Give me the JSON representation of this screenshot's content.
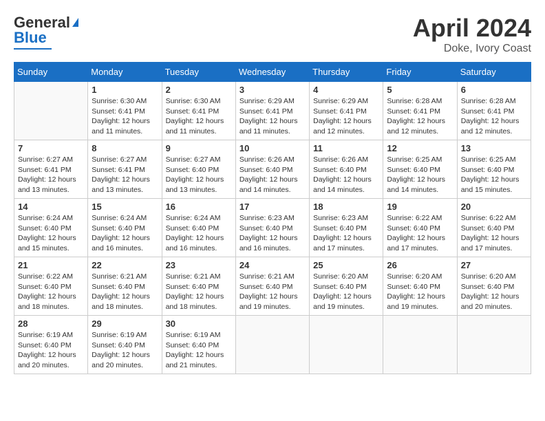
{
  "header": {
    "logo_line1": "General",
    "logo_line2": "Blue",
    "title": "April 2024",
    "location": "Doke, Ivory Coast"
  },
  "days_of_week": [
    "Sunday",
    "Monday",
    "Tuesday",
    "Wednesday",
    "Thursday",
    "Friday",
    "Saturday"
  ],
  "weeks": [
    [
      {
        "day": "",
        "info": ""
      },
      {
        "day": "1",
        "info": "Sunrise: 6:30 AM\nSunset: 6:41 PM\nDaylight: 12 hours\nand 11 minutes."
      },
      {
        "day": "2",
        "info": "Sunrise: 6:30 AM\nSunset: 6:41 PM\nDaylight: 12 hours\nand 11 minutes."
      },
      {
        "day": "3",
        "info": "Sunrise: 6:29 AM\nSunset: 6:41 PM\nDaylight: 12 hours\nand 11 minutes."
      },
      {
        "day": "4",
        "info": "Sunrise: 6:29 AM\nSunset: 6:41 PM\nDaylight: 12 hours\nand 12 minutes."
      },
      {
        "day": "5",
        "info": "Sunrise: 6:28 AM\nSunset: 6:41 PM\nDaylight: 12 hours\nand 12 minutes."
      },
      {
        "day": "6",
        "info": "Sunrise: 6:28 AM\nSunset: 6:41 PM\nDaylight: 12 hours\nand 12 minutes."
      }
    ],
    [
      {
        "day": "7",
        "info": "Sunrise: 6:27 AM\nSunset: 6:41 PM\nDaylight: 12 hours\nand 13 minutes."
      },
      {
        "day": "8",
        "info": "Sunrise: 6:27 AM\nSunset: 6:41 PM\nDaylight: 12 hours\nand 13 minutes."
      },
      {
        "day": "9",
        "info": "Sunrise: 6:27 AM\nSunset: 6:40 PM\nDaylight: 12 hours\nand 13 minutes."
      },
      {
        "day": "10",
        "info": "Sunrise: 6:26 AM\nSunset: 6:40 PM\nDaylight: 12 hours\nand 14 minutes."
      },
      {
        "day": "11",
        "info": "Sunrise: 6:26 AM\nSunset: 6:40 PM\nDaylight: 12 hours\nand 14 minutes."
      },
      {
        "day": "12",
        "info": "Sunrise: 6:25 AM\nSunset: 6:40 PM\nDaylight: 12 hours\nand 14 minutes."
      },
      {
        "day": "13",
        "info": "Sunrise: 6:25 AM\nSunset: 6:40 PM\nDaylight: 12 hours\nand 15 minutes."
      }
    ],
    [
      {
        "day": "14",
        "info": "Sunrise: 6:24 AM\nSunset: 6:40 PM\nDaylight: 12 hours\nand 15 minutes."
      },
      {
        "day": "15",
        "info": "Sunrise: 6:24 AM\nSunset: 6:40 PM\nDaylight: 12 hours\nand 16 minutes."
      },
      {
        "day": "16",
        "info": "Sunrise: 6:24 AM\nSunset: 6:40 PM\nDaylight: 12 hours\nand 16 minutes."
      },
      {
        "day": "17",
        "info": "Sunrise: 6:23 AM\nSunset: 6:40 PM\nDaylight: 12 hours\nand 16 minutes."
      },
      {
        "day": "18",
        "info": "Sunrise: 6:23 AM\nSunset: 6:40 PM\nDaylight: 12 hours\nand 17 minutes."
      },
      {
        "day": "19",
        "info": "Sunrise: 6:22 AM\nSunset: 6:40 PM\nDaylight: 12 hours\nand 17 minutes."
      },
      {
        "day": "20",
        "info": "Sunrise: 6:22 AM\nSunset: 6:40 PM\nDaylight: 12 hours\nand 17 minutes."
      }
    ],
    [
      {
        "day": "21",
        "info": "Sunrise: 6:22 AM\nSunset: 6:40 PM\nDaylight: 12 hours\nand 18 minutes."
      },
      {
        "day": "22",
        "info": "Sunrise: 6:21 AM\nSunset: 6:40 PM\nDaylight: 12 hours\nand 18 minutes."
      },
      {
        "day": "23",
        "info": "Sunrise: 6:21 AM\nSunset: 6:40 PM\nDaylight: 12 hours\nand 18 minutes."
      },
      {
        "day": "24",
        "info": "Sunrise: 6:21 AM\nSunset: 6:40 PM\nDaylight: 12 hours\nand 19 minutes."
      },
      {
        "day": "25",
        "info": "Sunrise: 6:20 AM\nSunset: 6:40 PM\nDaylight: 12 hours\nand 19 minutes."
      },
      {
        "day": "26",
        "info": "Sunrise: 6:20 AM\nSunset: 6:40 PM\nDaylight: 12 hours\nand 19 minutes."
      },
      {
        "day": "27",
        "info": "Sunrise: 6:20 AM\nSunset: 6:40 PM\nDaylight: 12 hours\nand 20 minutes."
      }
    ],
    [
      {
        "day": "28",
        "info": "Sunrise: 6:19 AM\nSunset: 6:40 PM\nDaylight: 12 hours\nand 20 minutes."
      },
      {
        "day": "29",
        "info": "Sunrise: 6:19 AM\nSunset: 6:40 PM\nDaylight: 12 hours\nand 20 minutes."
      },
      {
        "day": "30",
        "info": "Sunrise: 6:19 AM\nSunset: 6:40 PM\nDaylight: 12 hours\nand 21 minutes."
      },
      {
        "day": "",
        "info": ""
      },
      {
        "day": "",
        "info": ""
      },
      {
        "day": "",
        "info": ""
      },
      {
        "day": "",
        "info": ""
      }
    ]
  ]
}
